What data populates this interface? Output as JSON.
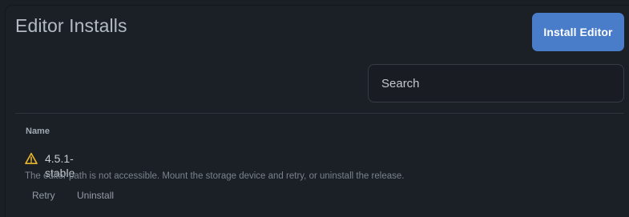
{
  "header": {
    "title": "Editor Installs",
    "install_button_label": "Install Editor"
  },
  "search": {
    "placeholder": "Search",
    "value": ""
  },
  "table": {
    "columns": [
      "Name"
    ],
    "rows": [
      {
        "name": "4.5.1-stable",
        "status_icon": "warning-icon",
        "status_color": "#e8b52b",
        "message": "The editor path is not accessible. Mount the storage device and retry, or uninstall the release.",
        "actions": [
          "Retry",
          "Uninstall"
        ]
      }
    ]
  },
  "colors": {
    "accent": "#4a7dc9",
    "background": "#1b2027",
    "warning": "#e8b52b"
  }
}
